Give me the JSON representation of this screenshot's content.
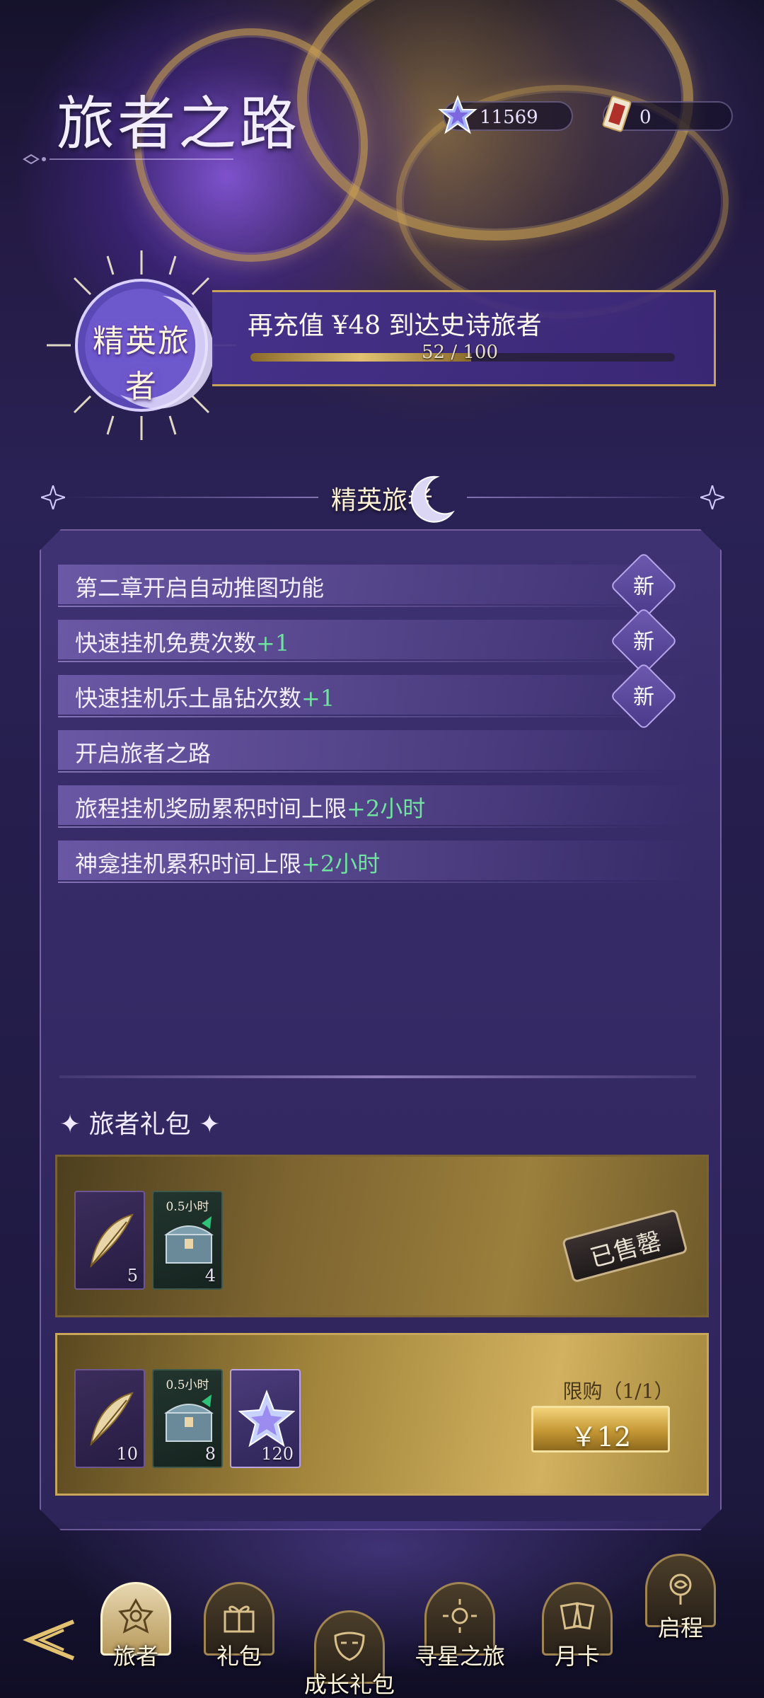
{
  "header": {
    "title": "旅者之路",
    "currencies": [
      {
        "icon": "star-crystal-icon",
        "value": "11569"
      },
      {
        "icon": "ticket-card-icon",
        "value": "0"
      }
    ]
  },
  "rank": {
    "name": "精英旅者",
    "message": "再充值 ¥48 到达史诗旅者",
    "progress_text": "52 / 100",
    "progress_current": 52,
    "progress_max": 100
  },
  "section": {
    "title": "精英旅者"
  },
  "benefits": [
    {
      "text": "第二章开启自动推图功能",
      "bonus": "",
      "badge": "新"
    },
    {
      "text": "快速挂机免费次数",
      "bonus": "+1",
      "badge": "新"
    },
    {
      "text": "快速挂机乐土晶钻次数",
      "bonus": "+1",
      "badge": "新"
    },
    {
      "text": "开启旅者之路",
      "bonus": "",
      "badge": ""
    },
    {
      "text": "旅程挂机奖励累积时间上限",
      "bonus": "+2小时",
      "badge": ""
    },
    {
      "text": "神龛挂机累积时间上限",
      "bonus": "+2小时",
      "badge": ""
    }
  ],
  "gifts": {
    "title": "旅者礼包",
    "bundles": [
      {
        "items": [
          {
            "icon": "feather-icon",
            "count": "5",
            "tag": ""
          },
          {
            "icon": "treasure-chest-icon",
            "count": "4",
            "tag": "0.5小时"
          }
        ],
        "status": "已售罄"
      },
      {
        "items": [
          {
            "icon": "feather-icon",
            "count": "10",
            "tag": ""
          },
          {
            "icon": "treasure-chest-icon",
            "count": "8",
            "tag": "0.5小时"
          },
          {
            "icon": "star-crystal-icon",
            "count": "120",
            "tag": ""
          }
        ],
        "limit": "限购（1/1）",
        "price": "￥12"
      }
    ]
  },
  "nav": [
    {
      "label": "旅者",
      "icon": "lotus-icon",
      "active": true
    },
    {
      "label": "礼包",
      "icon": "gift-icon",
      "active": false
    },
    {
      "label": "成长礼包",
      "icon": "mask-icon",
      "active": false
    },
    {
      "label": "寻星之旅",
      "icon": "sun-icon",
      "active": false
    },
    {
      "label": "月卡",
      "icon": "cards-icon",
      "active": false
    },
    {
      "label": "启程",
      "icon": "rose-icon",
      "active": false
    }
  ],
  "colors": {
    "accent_gold": "#c9a25a",
    "bonus_green": "#71e3a0",
    "panel_purple": "#3f3273"
  }
}
